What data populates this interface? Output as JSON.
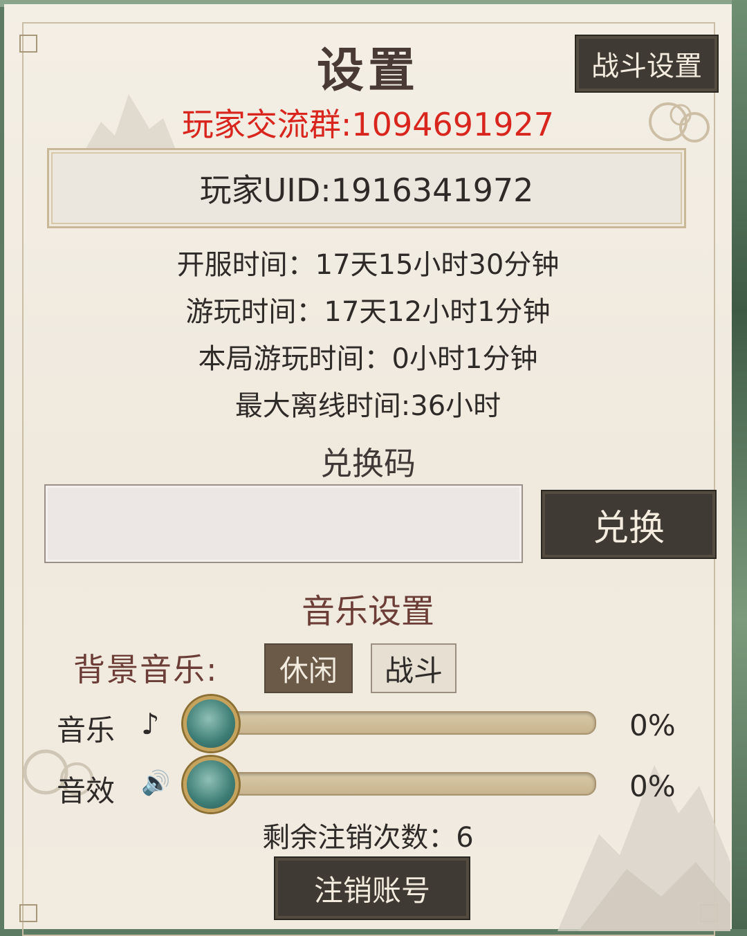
{
  "panel": {
    "title": "设置",
    "battle_settings_label": "战斗设置",
    "player_group": "玩家交流群:1094691927",
    "player_uid": "玩家UID:1916341972"
  },
  "info": {
    "server_time": "开服时间：17天15小时30分钟",
    "play_time": "游玩时间：17天12小时1分钟",
    "session_time": "本局游玩时间：0小时1分钟",
    "max_offline": "最大离线时间:36小时"
  },
  "redeem": {
    "title": "兑换码",
    "input_value": "",
    "button_label": "兑换"
  },
  "music": {
    "title": "音乐设置",
    "bgm_label": "背景音乐:",
    "bgm_options": [
      "休闲",
      "战斗"
    ],
    "bgm_selected": "休闲",
    "music_label": "音乐",
    "music_icon": "♪",
    "music_percent": "0%",
    "music_level": 0,
    "sfx_label": "音效",
    "sfx_icon": "🔊",
    "sfx_percent": "0%",
    "sfx_level": 0
  },
  "account": {
    "remaining_logouts": "剩余注销次数：6",
    "logout_button": "注销账号"
  },
  "colors": {
    "accent_red": "#d8261f",
    "button_dark": "#3f3a33",
    "label_brown": "#6b3d36"
  }
}
